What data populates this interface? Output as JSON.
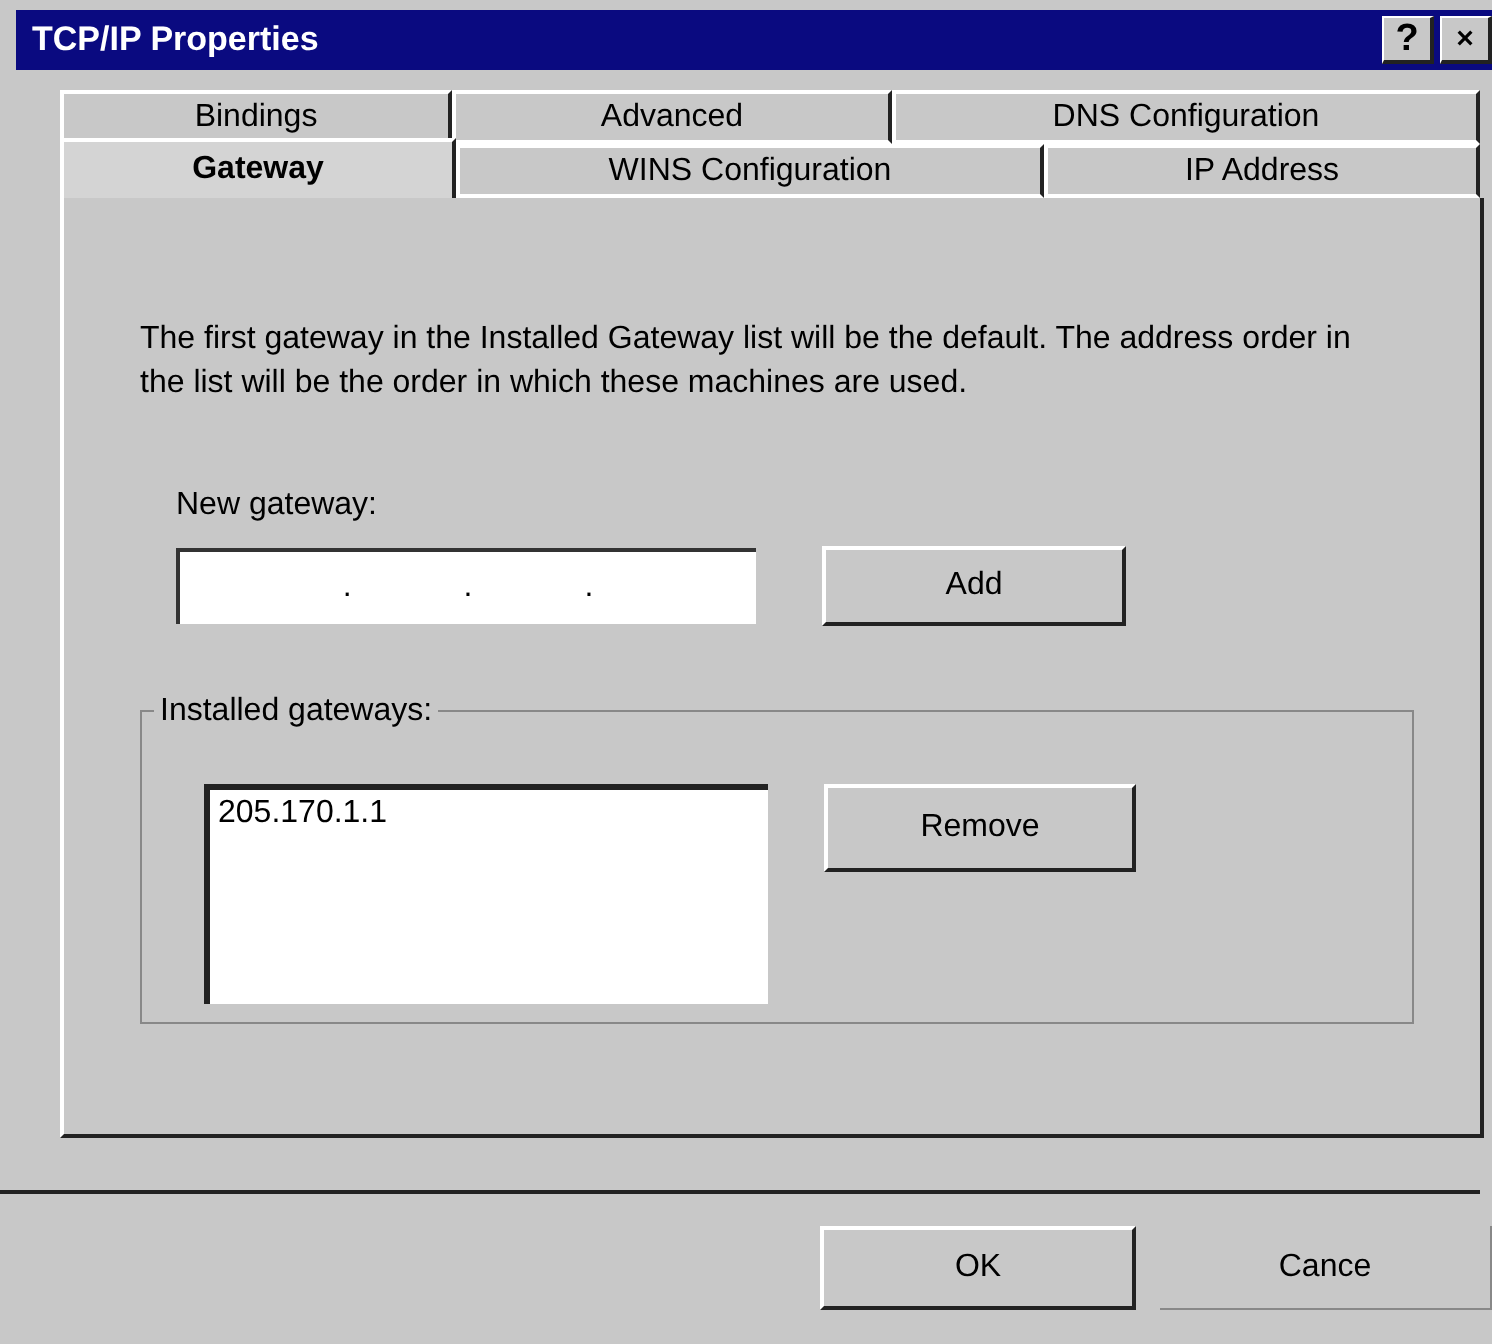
{
  "window": {
    "title": "TCP/IP Properties",
    "title_buttons": [
      {
        "kind": "help",
        "text": "?"
      },
      {
        "kind": "close",
        "text": "×"
      }
    ]
  },
  "tab_rows": [
    [
      {
        "label": "Bindings",
        "selected": false
      },
      {
        "label": "Advanced",
        "selected": false
      },
      {
        "label": "DNS Configuration",
        "selected": false
      }
    ],
    [
      {
        "label": "Gateway",
        "selected": true
      },
      {
        "label": "WINS Configuration",
        "selected": false
      },
      {
        "label": "IP Address",
        "selected": false
      }
    ]
  ],
  "description": "The first gateway in the Installed Gateway list will be the default. The address order in the list will be the order in which these machines are used.",
  "new_gateway": {
    "label": "New gateway:",
    "separators": [
      ".",
      ".",
      "."
    ],
    "button": "Add"
  },
  "installed_gateways": {
    "label": "Installed gateways:",
    "items": [
      "205.170.1.1"
    ],
    "button": "Remove"
  },
  "buttons": [
    "OK",
    "Cance"
  ]
}
